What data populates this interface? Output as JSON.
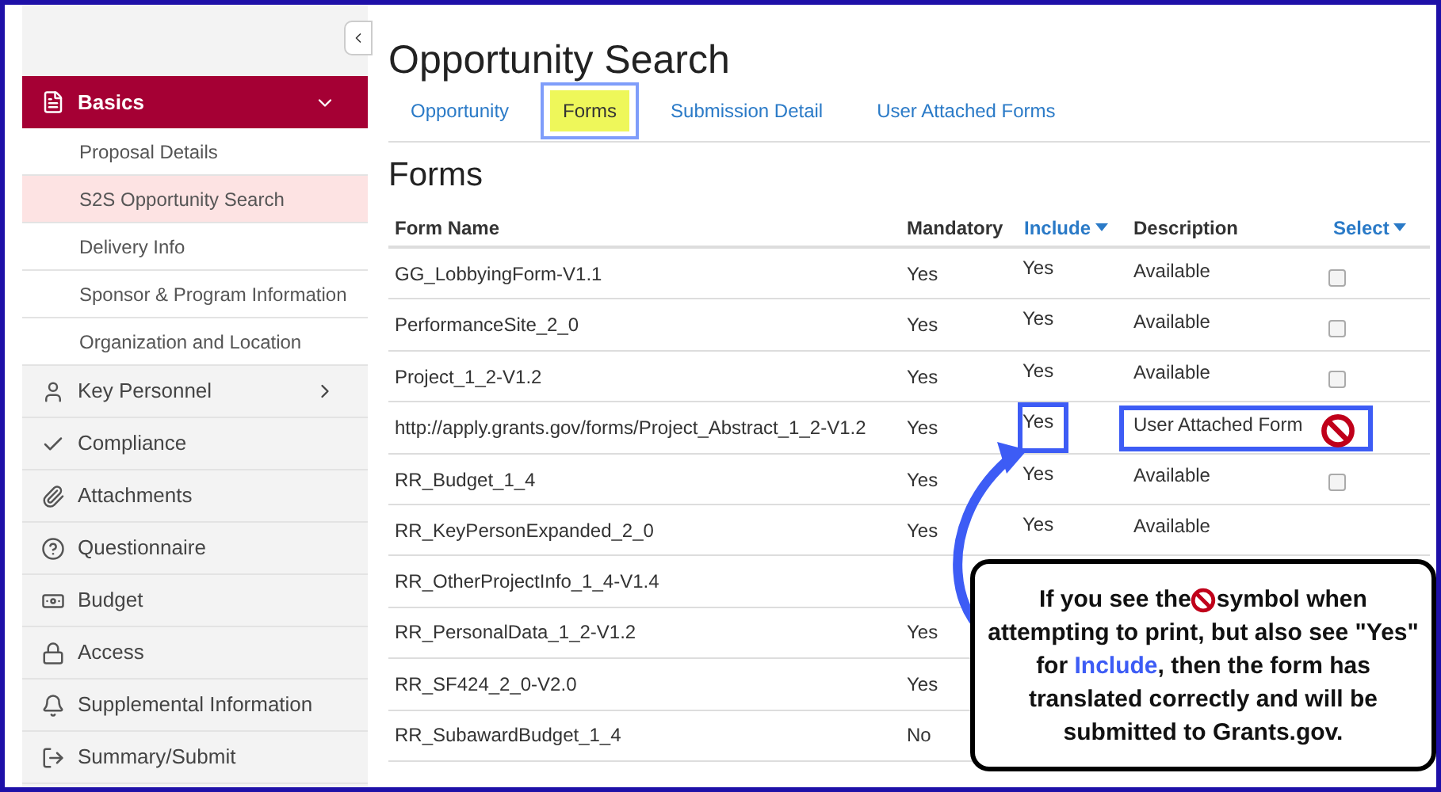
{
  "sidebar": {
    "items": [
      {
        "label": "Basics",
        "kind": "group",
        "expanded": true,
        "children": [
          {
            "label": "Proposal Details",
            "selected": false
          },
          {
            "label": "S2S Opportunity Search",
            "selected": true
          },
          {
            "label": "Delivery Info",
            "selected": false
          },
          {
            "label": "Sponsor & Program Information",
            "selected": false
          },
          {
            "label": "Organization and Location",
            "selected": false
          }
        ]
      },
      {
        "label": "Key Personnel",
        "kind": "group",
        "expanded": false
      },
      {
        "label": "Compliance",
        "kind": "link"
      },
      {
        "label": "Attachments",
        "kind": "link"
      },
      {
        "label": "Questionnaire",
        "kind": "link"
      },
      {
        "label": "Budget",
        "kind": "link"
      },
      {
        "label": "Access",
        "kind": "link"
      },
      {
        "label": "Supplemental Information",
        "kind": "link"
      },
      {
        "label": "Summary/Submit",
        "kind": "link"
      }
    ]
  },
  "page": {
    "title": "Opportunity Search"
  },
  "tabs": [
    {
      "label": "Opportunity",
      "selected": false,
      "highlighted": false
    },
    {
      "label": "Forms",
      "selected": true,
      "highlighted": true
    },
    {
      "label": "Submission Detail",
      "selected": false,
      "highlighted": false
    },
    {
      "label": "User Attached Forms",
      "selected": false,
      "highlighted": false
    }
  ],
  "section_title": "Forms",
  "table": {
    "columns": [
      {
        "label": "Form Name",
        "sortable": false
      },
      {
        "label": "Mandatory",
        "sortable": false
      },
      {
        "label": "Include",
        "sortable": true
      },
      {
        "label": "Description",
        "sortable": false
      },
      {
        "label": "Select",
        "sortable": true
      }
    ],
    "rows": [
      {
        "name": "GG_LobbyingForm-V1.1",
        "mandatory": "Yes",
        "include": "Yes",
        "description": "Available",
        "kind": "checkbox",
        "checked": false
      },
      {
        "name": "PerformanceSite_2_0",
        "mandatory": "Yes",
        "include": "Yes",
        "description": "Available",
        "kind": "checkbox",
        "checked": false
      },
      {
        "name": "Project_1_2-V1.2",
        "mandatory": "Yes",
        "include": "Yes",
        "description": "Available",
        "kind": "checkbox",
        "checked": false
      },
      {
        "name": "http://apply.grants.gov/forms/Project_Abstract_1_2-V1.2",
        "mandatory": "Yes",
        "include": "Yes",
        "description": "User Attached Form",
        "kind": "blocked",
        "highlighted": true
      },
      {
        "name": "RR_Budget_1_4",
        "mandatory": "Yes",
        "include": "Yes",
        "description": "Available",
        "kind": "checkbox",
        "checked": false
      },
      {
        "name": "RR_KeyPersonExpanded_2_0",
        "mandatory": "Yes",
        "include": "Yes",
        "description": "Available"
      },
      {
        "name": "RR_OtherProjectInfo_1_4-V1.4"
      },
      {
        "name": "RR_PersonalData_1_2-V1.2",
        "mandatory": "Yes"
      },
      {
        "name": "RR_SF424_2_0-V2.0",
        "mandatory": "Yes"
      },
      {
        "name": "RR_SubawardBudget_1_4",
        "mandatory": "No"
      }
    ]
  },
  "callout": {
    "text_before": "If you see the",
    "text_middle": "symbol when attempting to print, but also see \"Yes\" for",
    "keyword": "Include",
    "text_after": ", then the form has translated correctly and will be submitted to Grants.gov."
  }
}
